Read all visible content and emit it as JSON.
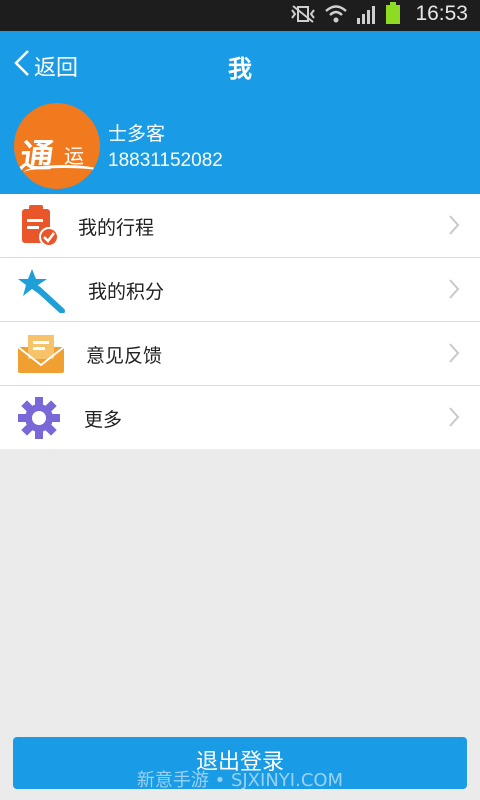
{
  "status_bar": {
    "time": "16:53"
  },
  "header": {
    "back_label": "返回",
    "title": "我"
  },
  "profile": {
    "logo_main": "通",
    "logo_sub": "运",
    "name": "士多客",
    "phone": "18831152082"
  },
  "menu": {
    "items": [
      {
        "label": "我的行程",
        "icon": "clipboard-check-icon",
        "color": "#e8562a"
      },
      {
        "label": "我的积分",
        "icon": "magic-wand-icon",
        "color": "#1e9fd8"
      },
      {
        "label": "意见反馈",
        "icon": "envelope-icon",
        "color": "#f0a030"
      },
      {
        "label": "更多",
        "icon": "gear-icon",
        "color": "#7b68d8"
      }
    ]
  },
  "logout_label": "退出登录",
  "watermark": "新意手游 • SJXINYI.COM",
  "colors": {
    "accent": "#1a9be6",
    "background": "#ebebeb"
  }
}
